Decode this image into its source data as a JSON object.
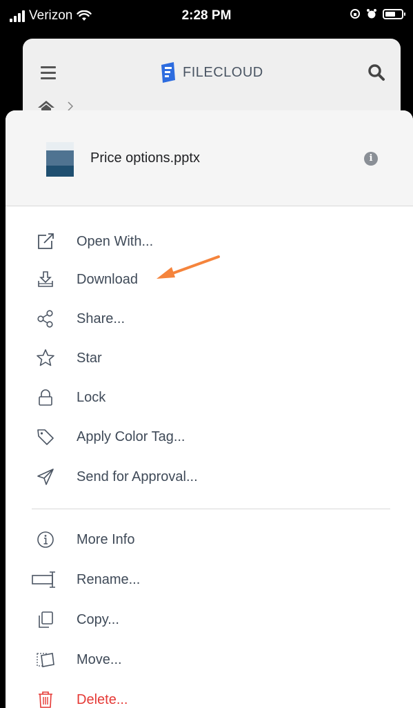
{
  "status_bar": {
    "carrier": "Verizon",
    "time": "2:28 PM"
  },
  "app_header": {
    "brand": "FILECLOUD"
  },
  "file": {
    "name": "Price options.pptx"
  },
  "menu": {
    "items": [
      {
        "label": "Open With...",
        "icon": "open-with-icon"
      },
      {
        "label": "Download",
        "icon": "download-icon"
      },
      {
        "label": "Share...",
        "icon": "share-icon"
      },
      {
        "label": "Star",
        "icon": "star-icon"
      },
      {
        "label": "Lock",
        "icon": "lock-icon"
      },
      {
        "label": "Apply Color Tag...",
        "icon": "tag-icon"
      },
      {
        "label": "Send for Approval...",
        "icon": "send-icon"
      },
      {
        "label": "More Info",
        "icon": "info-icon"
      },
      {
        "label": "Rename...",
        "icon": "rename-icon"
      },
      {
        "label": "Copy...",
        "icon": "copy-icon"
      },
      {
        "label": "Move...",
        "icon": "move-icon"
      },
      {
        "label": "Delete...",
        "icon": "trash-icon"
      }
    ]
  },
  "colors": {
    "text": "#3f4a58",
    "danger": "#e53935",
    "annotation_arrow": "#f5843c",
    "brand_blue": "#2d6cdf"
  }
}
